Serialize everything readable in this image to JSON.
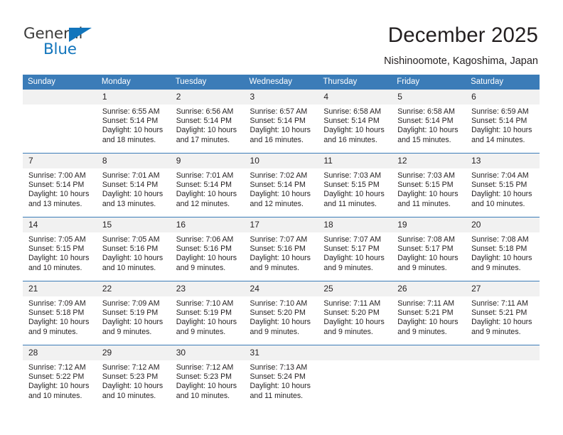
{
  "brand": {
    "name_top": "General",
    "name_bottom": "Blue",
    "accent_color": "#1275bc"
  },
  "header": {
    "title": "December 2025",
    "subtitle": "Nishinoomote, Kagoshima, Japan"
  },
  "theme": {
    "header_blue": "#3b7cb8",
    "daynum_band": "#f1f1f1",
    "text": "#231f20"
  },
  "weekdays": [
    "Sunday",
    "Monday",
    "Tuesday",
    "Wednesday",
    "Thursday",
    "Friday",
    "Saturday"
  ],
  "weeks": [
    [
      {
        "day": "",
        "info": ""
      },
      {
        "day": "1",
        "info": "Sunrise: 6:55 AM\nSunset: 5:14 PM\nDaylight: 10 hours\nand 18 minutes."
      },
      {
        "day": "2",
        "info": "Sunrise: 6:56 AM\nSunset: 5:14 PM\nDaylight: 10 hours\nand 17 minutes."
      },
      {
        "day": "3",
        "info": "Sunrise: 6:57 AM\nSunset: 5:14 PM\nDaylight: 10 hours\nand 16 minutes."
      },
      {
        "day": "4",
        "info": "Sunrise: 6:58 AM\nSunset: 5:14 PM\nDaylight: 10 hours\nand 16 minutes."
      },
      {
        "day": "5",
        "info": "Sunrise: 6:58 AM\nSunset: 5:14 PM\nDaylight: 10 hours\nand 15 minutes."
      },
      {
        "day": "6",
        "info": "Sunrise: 6:59 AM\nSunset: 5:14 PM\nDaylight: 10 hours\nand 14 minutes."
      }
    ],
    [
      {
        "day": "7",
        "info": "Sunrise: 7:00 AM\nSunset: 5:14 PM\nDaylight: 10 hours\nand 13 minutes."
      },
      {
        "day": "8",
        "info": "Sunrise: 7:01 AM\nSunset: 5:14 PM\nDaylight: 10 hours\nand 13 minutes."
      },
      {
        "day": "9",
        "info": "Sunrise: 7:01 AM\nSunset: 5:14 PM\nDaylight: 10 hours\nand 12 minutes."
      },
      {
        "day": "10",
        "info": "Sunrise: 7:02 AM\nSunset: 5:14 PM\nDaylight: 10 hours\nand 12 minutes."
      },
      {
        "day": "11",
        "info": "Sunrise: 7:03 AM\nSunset: 5:15 PM\nDaylight: 10 hours\nand 11 minutes."
      },
      {
        "day": "12",
        "info": "Sunrise: 7:03 AM\nSunset: 5:15 PM\nDaylight: 10 hours\nand 11 minutes."
      },
      {
        "day": "13",
        "info": "Sunrise: 7:04 AM\nSunset: 5:15 PM\nDaylight: 10 hours\nand 10 minutes."
      }
    ],
    [
      {
        "day": "14",
        "info": "Sunrise: 7:05 AM\nSunset: 5:15 PM\nDaylight: 10 hours\nand 10 minutes."
      },
      {
        "day": "15",
        "info": "Sunrise: 7:05 AM\nSunset: 5:16 PM\nDaylight: 10 hours\nand 10 minutes."
      },
      {
        "day": "16",
        "info": "Sunrise: 7:06 AM\nSunset: 5:16 PM\nDaylight: 10 hours\nand 9 minutes."
      },
      {
        "day": "17",
        "info": "Sunrise: 7:07 AM\nSunset: 5:16 PM\nDaylight: 10 hours\nand 9 minutes."
      },
      {
        "day": "18",
        "info": "Sunrise: 7:07 AM\nSunset: 5:17 PM\nDaylight: 10 hours\nand 9 minutes."
      },
      {
        "day": "19",
        "info": "Sunrise: 7:08 AM\nSunset: 5:17 PM\nDaylight: 10 hours\nand 9 minutes."
      },
      {
        "day": "20",
        "info": "Sunrise: 7:08 AM\nSunset: 5:18 PM\nDaylight: 10 hours\nand 9 minutes."
      }
    ],
    [
      {
        "day": "21",
        "info": "Sunrise: 7:09 AM\nSunset: 5:18 PM\nDaylight: 10 hours\nand 9 minutes."
      },
      {
        "day": "22",
        "info": "Sunrise: 7:09 AM\nSunset: 5:19 PM\nDaylight: 10 hours\nand 9 minutes."
      },
      {
        "day": "23",
        "info": "Sunrise: 7:10 AM\nSunset: 5:19 PM\nDaylight: 10 hours\nand 9 minutes."
      },
      {
        "day": "24",
        "info": "Sunrise: 7:10 AM\nSunset: 5:20 PM\nDaylight: 10 hours\nand 9 minutes."
      },
      {
        "day": "25",
        "info": "Sunrise: 7:11 AM\nSunset: 5:20 PM\nDaylight: 10 hours\nand 9 minutes."
      },
      {
        "day": "26",
        "info": "Sunrise: 7:11 AM\nSunset: 5:21 PM\nDaylight: 10 hours\nand 9 minutes."
      },
      {
        "day": "27",
        "info": "Sunrise: 7:11 AM\nSunset: 5:21 PM\nDaylight: 10 hours\nand 9 minutes."
      }
    ],
    [
      {
        "day": "28",
        "info": "Sunrise: 7:12 AM\nSunset: 5:22 PM\nDaylight: 10 hours\nand 10 minutes."
      },
      {
        "day": "29",
        "info": "Sunrise: 7:12 AM\nSunset: 5:23 PM\nDaylight: 10 hours\nand 10 minutes."
      },
      {
        "day": "30",
        "info": "Sunrise: 7:12 AM\nSunset: 5:23 PM\nDaylight: 10 hours\nand 10 minutes."
      },
      {
        "day": "31",
        "info": "Sunrise: 7:13 AM\nSunset: 5:24 PM\nDaylight: 10 hours\nand 11 minutes."
      },
      {
        "day": "",
        "info": ""
      },
      {
        "day": "",
        "info": ""
      },
      {
        "day": "",
        "info": ""
      }
    ]
  ]
}
